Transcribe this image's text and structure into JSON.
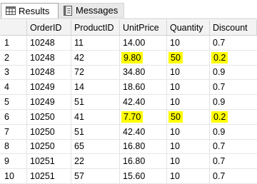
{
  "tabs": [
    {
      "label": "Results",
      "icon": "grid-icon",
      "active": true
    },
    {
      "label": "Messages",
      "icon": "messages-icon",
      "active": false
    }
  ],
  "highlight_color": "#ffff00",
  "columns": [
    "",
    "OrderID",
    "ProductID",
    "UnitPrice",
    "Quantity",
    "Discount"
  ],
  "rows": [
    {
      "rn": "1",
      "order_id": "10248",
      "product_id": "11",
      "unit_price": "14.00",
      "quantity": "10",
      "discount": "0.7",
      "highlight": false
    },
    {
      "rn": "2",
      "order_id": "10248",
      "product_id": "42",
      "unit_price": "9.80",
      "quantity": "50",
      "discount": "0.2",
      "highlight": true
    },
    {
      "rn": "3",
      "order_id": "10248",
      "product_id": "72",
      "unit_price": "34.80",
      "quantity": "10",
      "discount": "0.9",
      "highlight": false
    },
    {
      "rn": "4",
      "order_id": "10249",
      "product_id": "14",
      "unit_price": "18.60",
      "quantity": "10",
      "discount": "0.7",
      "highlight": false
    },
    {
      "rn": "5",
      "order_id": "10249",
      "product_id": "51",
      "unit_price": "42.40",
      "quantity": "10",
      "discount": "0.9",
      "highlight": false
    },
    {
      "rn": "6",
      "order_id": "10250",
      "product_id": "41",
      "unit_price": "7.70",
      "quantity": "50",
      "discount": "0.2",
      "highlight": true
    },
    {
      "rn": "7",
      "order_id": "10250",
      "product_id": "51",
      "unit_price": "42.40",
      "quantity": "10",
      "discount": "0.9",
      "highlight": false
    },
    {
      "rn": "8",
      "order_id": "10250",
      "product_id": "65",
      "unit_price": "16.80",
      "quantity": "10",
      "discount": "0.7",
      "highlight": false
    },
    {
      "rn": "9",
      "order_id": "10251",
      "product_id": "22",
      "unit_price": "16.80",
      "quantity": "10",
      "discount": "0.7",
      "highlight": false
    },
    {
      "rn": "10",
      "order_id": "10251",
      "product_id": "57",
      "unit_price": "15.60",
      "quantity": "10",
      "discount": "0.7",
      "highlight": false
    }
  ]
}
